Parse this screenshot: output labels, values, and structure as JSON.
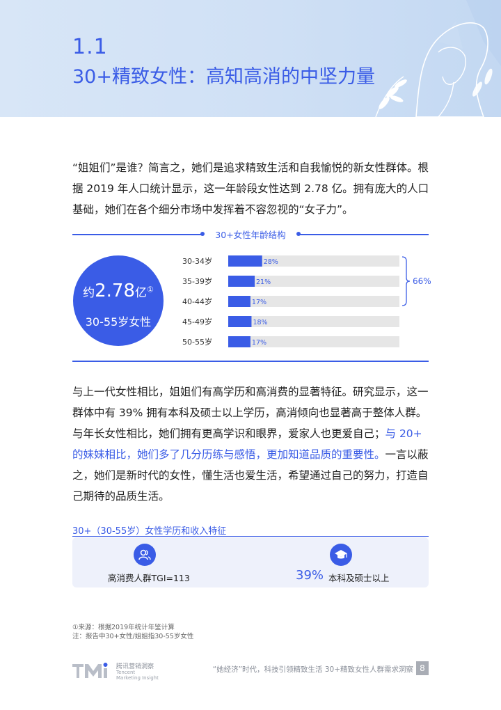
{
  "section": {
    "number": "1.1",
    "title": "30+精致女性：高知高消的中坚力量"
  },
  "para1": "“姐姐们”是谁？简言之，她们是追求精致生活和自我愉悦的新女性群体。根据 2019 年人口统计显示，这一年龄段女性达到 2.78 亿。拥有庞大的人口基础，她们在各个细分市场中发挥着不容忽视的“女子力”。",
  "chart_data": {
    "type": "bar",
    "title": "30+女性年龄结构",
    "categories": [
      "30-34岁",
      "35-39岁",
      "40-44岁",
      "45-49岁",
      "50-55岁"
    ],
    "values": [
      28,
      21,
      17,
      18,
      17
    ],
    "value_labels": [
      "28%",
      "21%",
      "17%",
      "18%",
      "17%"
    ],
    "max": 100,
    "bracket_label": "66%",
    "bracket_covers": [
      "30-34岁",
      "35-39岁",
      "40-44岁"
    ],
    "colors": {
      "bar": "#3a5ce6",
      "track": "#e6e6e6",
      "accent": "#3a5ce6"
    }
  },
  "circle": {
    "prefix": "约",
    "number": "2.78",
    "unit": "亿",
    "note": "①",
    "subtitle": "30-55岁女性"
  },
  "para2": {
    "part1": "与上一代女性相比，姐姐们有高学历和高消费的显著特征。研究显示，这一群体中有 39% 拥有本科及硕士以上学历，高消倾向也显著高于整体人群。与年长女性相比，她们拥有更高学识和眼界，爱家人也更爱自己；",
    "highlight": "与 20+ 的妹妹相比，她们多了几分历练与感悟，更加知道品质的重要性。",
    "part2": "一言以蔽之，她们是新时代的女性，懂生活也爱生活，希望通过自己的努力，打造自己期待的品质生活。"
  },
  "features": {
    "title": "30+（30-55岁）女性学历和收入特征",
    "item1": {
      "icon": "people-icon",
      "label": "高消费人群TGI=113"
    },
    "item2": {
      "icon": "graduation-cap-icon",
      "number": "39%",
      "label": "本科及硕士以上"
    }
  },
  "footnotes": {
    "source": "①来源：根据2019年统计年鉴计算",
    "note": "注：报告中30+女性/姐姐指30-55岁女性"
  },
  "footer": {
    "logo_cn": "腾讯营销洞察",
    "logo_en_1": "Tencent",
    "logo_en_2": "Marketing Insight",
    "report_title": "“她经济”时代，科技引领精致生活 30+精致女性人群需求洞察",
    "page_number": "8"
  },
  "colors": {
    "accent": "#3a5ce6",
    "panel": "#eef1fb"
  }
}
